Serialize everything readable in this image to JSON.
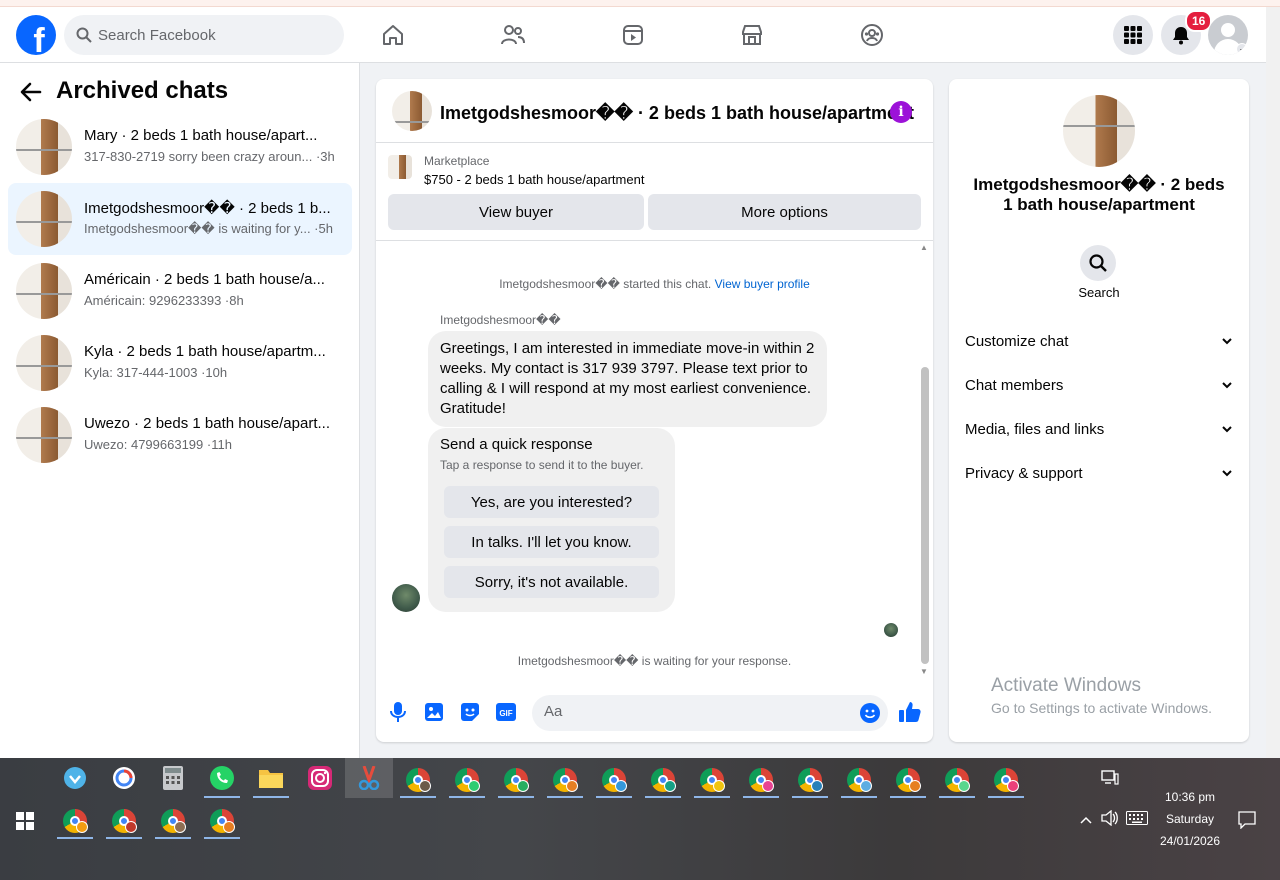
{
  "header": {
    "logo_letter": "f",
    "search_placeholder": "Search Facebook",
    "notifications_count": "16",
    "nav": [
      "home-icon",
      "friends-icon",
      "watch-icon",
      "marketplace-icon",
      "groups-icon"
    ],
    "brand_color": "#0866ff"
  },
  "left": {
    "title": "Archived chats",
    "chats": [
      {
        "name": "Mary · 2 beds 1 bath house/apart...",
        "snippet": "317-830-2719 sorry been crazy aroun... ·3h"
      },
      {
        "name": "Imetgodshesmoor�� · 2 beds 1 b...",
        "snippet": "Imetgodshesmoor�� is waiting for y... ·5h"
      },
      {
        "name": "Américain · 2 beds 1 bath house/a...",
        "snippet": "Américain: 9296233393 ·8h"
      },
      {
        "name": "Kyla · 2 beds 1 bath house/apartm...",
        "snippet": "Kyla: 317-444-1003 ·10h"
      },
      {
        "name": "Uwezo · 2 beds 1 bath house/apart...",
        "snippet": "Uwezo: 4799663199 ·11h"
      }
    ]
  },
  "chat": {
    "title": "Imetgodshesmoor�� · 2 beds 1 bath house/apartment",
    "marketplace_label": "Marketplace",
    "listing": "$750 - 2 beds 1 bath house/apartment",
    "view_buyer": "View buyer",
    "more_options": "More options",
    "started_text": "Imetgodshesmoor�� started this chat.",
    "view_buyer_profile": "View buyer profile",
    "sender": "Imetgodshesmoor��",
    "message": "Greetings, I am interested in immediate move-in within 2 weeks. My contact is 317 939 3797. Please text prior to calling & I will respond at my most earliest convenience. Gratitude!",
    "quick_title": "Send a quick response",
    "quick_sub": "Tap a response to send it to the buyer.",
    "quick_options": [
      "Yes, are you interested?",
      "In talks. I'll let you know.",
      "Sorry, it's not available."
    ],
    "waiting_text": "Imetgodshesmoor�� is waiting for your response.",
    "composer_placeholder": "Aa"
  },
  "details": {
    "title": "Imetgodshesmoor�� · 2 beds 1 bath house/apartment",
    "search_label": "Search",
    "sections": [
      "Customize chat",
      "Chat members",
      "Media, files and links",
      "Privacy & support"
    ],
    "activate_title": "Activate Windows",
    "activate_sub": "Go to Settings to activate Windows."
  },
  "taskbar": {
    "time": "10:36 pm",
    "day": "Saturday",
    "date": "24/01/2026"
  }
}
